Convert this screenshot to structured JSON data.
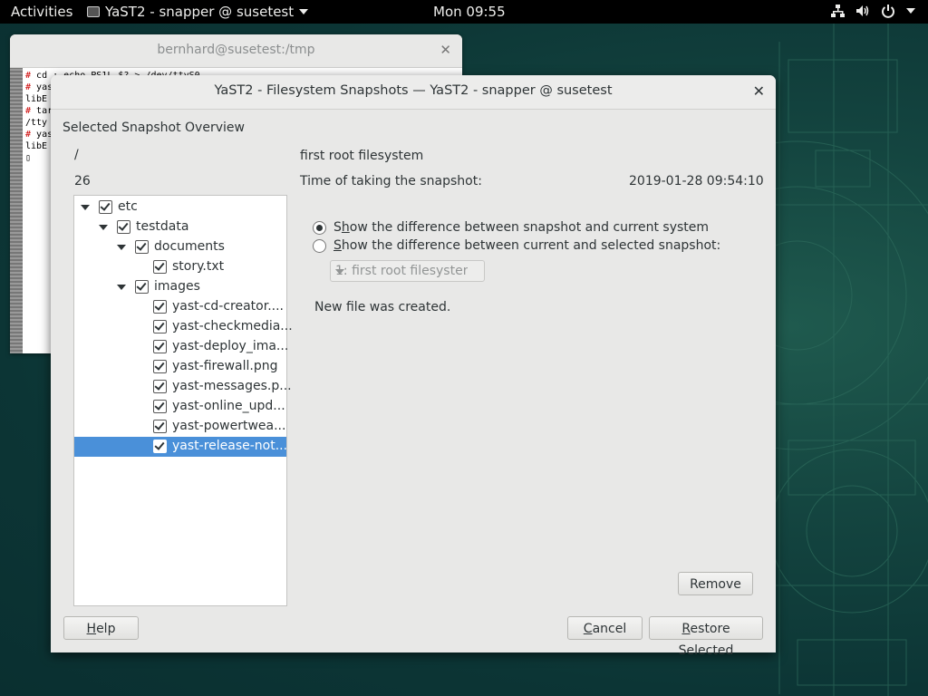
{
  "topbar": {
    "activities": "Activities",
    "app_menu": "YaST2 - snapper @ susetest",
    "clock": "Mon 09:55",
    "icons": [
      "network-icon",
      "volume-icon",
      "power-icon"
    ]
  },
  "terminal": {
    "title": "bernhard@susetest:/tmp",
    "lines": [
      {
        "mark": "#",
        "text": " cd ; echo PS1L $? > /dev/ttyS0"
      },
      {
        "mark": "#",
        "text": " yas"
      },
      {
        "mark": "",
        "text": "libE"
      },
      {
        "mark": "#",
        "text": " tar"
      },
      {
        "mark": "",
        "text": "/tty"
      },
      {
        "mark": "#",
        "text": " yas"
      },
      {
        "mark": "",
        "text": "libE"
      },
      {
        "mark": "",
        "text": "▯"
      }
    ]
  },
  "dialog": {
    "title": "YaST2 - Filesystem Snapshots — YaST2 - snapper @ susetest",
    "heading": "Selected Snapshot Overview",
    "path": "/",
    "number": "26",
    "tree": [
      {
        "label": "etc",
        "level": 0,
        "expander": true
      },
      {
        "label": "testdata",
        "level": 1,
        "expander": true
      },
      {
        "label": "documents",
        "level": 2,
        "expander": true
      },
      {
        "label": "story.txt",
        "level": 3,
        "expander": false
      },
      {
        "label": "images",
        "level": 2,
        "expander": true
      },
      {
        "label": "yast-cd-creator....",
        "level": 3,
        "expander": false
      },
      {
        "label": "yast-checkmedia...",
        "level": 3,
        "expander": false
      },
      {
        "label": "yast-deploy_ima...",
        "level": 3,
        "expander": false
      },
      {
        "label": "yast-firewall.png",
        "level": 3,
        "expander": false
      },
      {
        "label": "yast-messages.p...",
        "level": 3,
        "expander": false
      },
      {
        "label": "yast-online_upd...",
        "level": 3,
        "expander": false
      },
      {
        "label": "yast-powertwea...",
        "level": 3,
        "expander": false
      },
      {
        "label": "yast-release-not...",
        "level": 3,
        "expander": false,
        "selected": true
      }
    ],
    "description": "first root filesystem",
    "time_label": "Time of taking the snapshot:",
    "time_value": "2019-01-28 09:54:10",
    "radio1_pre": "S",
    "radio1_key": "h",
    "radio1_post": "ow the difference between snapshot and current system",
    "radio2_key": "S",
    "radio2_post": "how the difference between current and selected snapshot:",
    "combo_value": "1: first root filesystem",
    "message": "New file was created.",
    "remove": "Remove",
    "help_key": "H",
    "help_post": "elp",
    "cancel_key": "C",
    "cancel_post": "ancel",
    "restore_key": "R",
    "restore_post": "estore Selected"
  }
}
